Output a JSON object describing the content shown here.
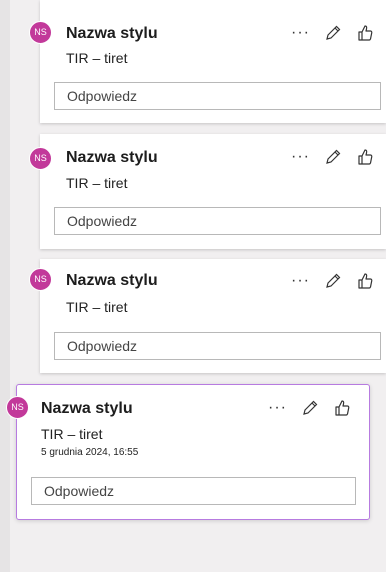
{
  "comments": [
    {
      "avatar": "NS",
      "name": "Nazwa stylu",
      "subtitle": "TIR – tiret",
      "timestamp": "",
      "reply_placeholder": "Odpowiedz",
      "more_label": "···"
    },
    {
      "avatar": "NS",
      "name": "Nazwa stylu",
      "subtitle": "TIR – tiret",
      "timestamp": "",
      "reply_placeholder": "Odpowiedz",
      "more_label": "···"
    },
    {
      "avatar": "NS",
      "name": "Nazwa stylu",
      "subtitle": "TIR – tiret",
      "timestamp": "",
      "reply_placeholder": "Odpowiedz",
      "more_label": "···"
    },
    {
      "avatar": "NS",
      "name": "Nazwa stylu",
      "subtitle": "TIR – tiret",
      "timestamp": "5 grudnia 2024, 16:55",
      "reply_placeholder": "Odpowiedz",
      "more_label": "···"
    }
  ],
  "colors": {
    "avatar": "#c2399a",
    "active_border": "#b77be0"
  },
  "icons": {
    "more": "more-icon",
    "edit": "pencil-icon",
    "like": "thumbs-up-icon"
  }
}
